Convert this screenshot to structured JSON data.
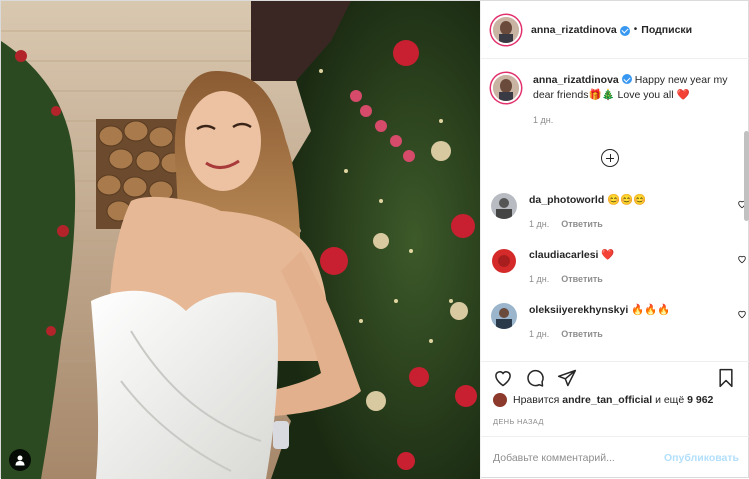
{
  "post": {
    "author": "anna_rizatdinova",
    "follow_label": "Подписки",
    "dot": "•",
    "caption": {
      "author": "anna_rizatdinova",
      "text": "Happy new year my dear friends🎁🎄 Love you all ❤️",
      "time": "1 дн."
    },
    "comments": [
      {
        "user": "da_photoworld",
        "text": "😊😊😊",
        "time": "1 дн.",
        "reply": "Ответить"
      },
      {
        "user": "claudiacarlesi",
        "text": "❤️",
        "time": "1 дн.",
        "reply": "Ответить"
      },
      {
        "user": "oleksiiyerekhynskyi",
        "text": "🔥🔥🔥",
        "time": "1 дн.",
        "reply": "Ответить"
      }
    ],
    "likes": {
      "prefix": "Нравится",
      "user": "andre_tan_official",
      "middle": "и ещё",
      "count": "9 962"
    },
    "posted_ago": "ДЕНЬ НАЗАД",
    "comment_input": {
      "placeholder": "Добавьте комментарий..."
    },
    "publish_label": "Опубликовать"
  },
  "icons": {
    "verified": "verified-badge-icon",
    "more_comments": "plus-circle-icon",
    "like": "heart-icon",
    "comment": "comment-bubble-icon",
    "share": "paper-plane-icon",
    "save": "bookmark-icon",
    "tagged": "user-tag-icon"
  },
  "colors": {
    "accent": "#3897f0",
    "publish_disabled": "#b2dffc",
    "heart_red": "#ed4956"
  }
}
